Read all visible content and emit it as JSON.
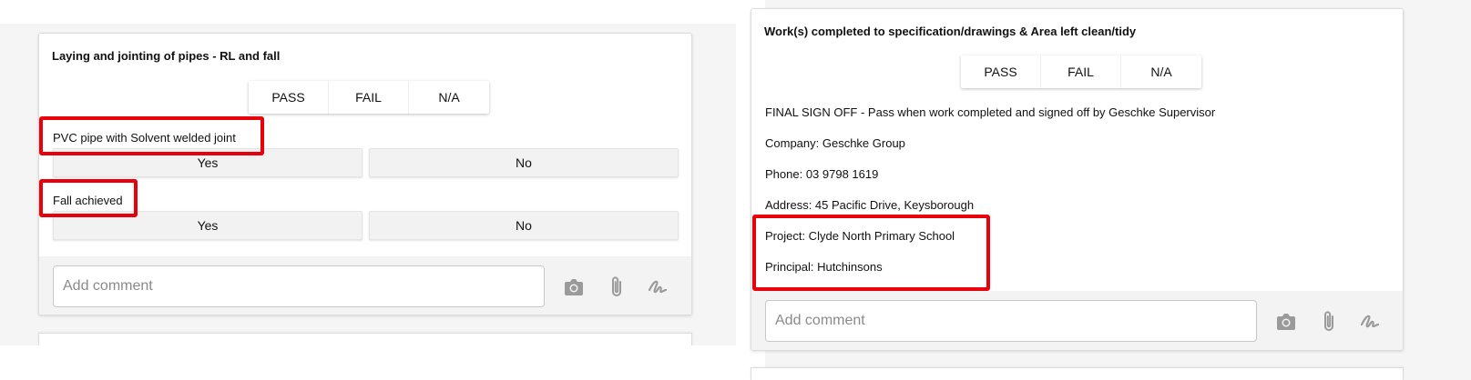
{
  "left_card": {
    "title": "Laying and jointing of pipes - RL and fall",
    "result_options": [
      "PASS",
      "FAIL",
      "N/A"
    ],
    "questions": [
      {
        "label": "PVC pipe with Solvent welded joint",
        "yes": "Yes",
        "no": "No"
      },
      {
        "label": "Fall achieved",
        "yes": "Yes",
        "no": "No"
      }
    ],
    "comment_placeholder": "Add comment"
  },
  "right_card": {
    "title": "Work(s) completed to specification/drawings & Area left clean/tidy",
    "result_options": [
      "PASS",
      "FAIL",
      "N/A"
    ],
    "lines": [
      "FINAL SIGN OFF - Pass when work completed and signed off by Geschke Supervisor",
      "Company: Geschke Group",
      "Phone: 03 9798 1619",
      "Address: 45 Pacific Drive, Keysborough",
      "Project: Clyde North Primary School",
      "Principal: Hutchinsons"
    ],
    "comment_placeholder": "Add comment"
  },
  "icons": {
    "camera": "camera-icon",
    "attachment": "paperclip-icon",
    "signature": "signature-icon"
  },
  "colors": {
    "highlight": "#e8000b",
    "icon_gray": "#9a9a9a",
    "footer_bg": "#f3f3f3"
  }
}
